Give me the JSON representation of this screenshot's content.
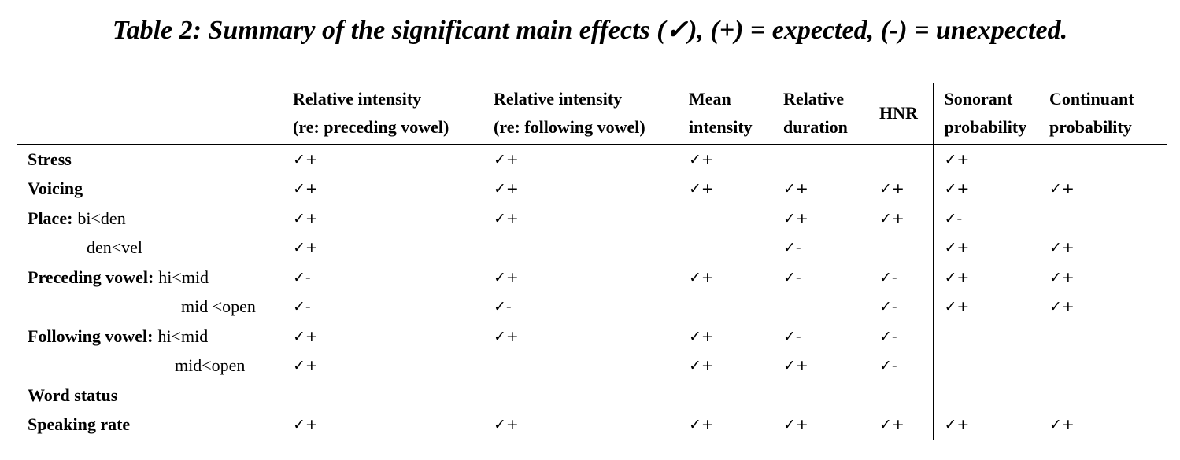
{
  "title": "Table 2: Summary of the significant main effects (✓), (+) = expected, (-) = unexpected.",
  "columns": [
    {
      "line1": "Relative intensity",
      "line2": "(re: preceding vowel)"
    },
    {
      "line1": "Relative intensity",
      "line2": "(re: following vowel)"
    },
    {
      "line1": "Mean",
      "line2": "intensity"
    },
    {
      "line1": "Relative",
      "line2": "duration"
    },
    {
      "line1": "HNR",
      "line2": ""
    },
    {
      "line1": "Sonorant",
      "line2": "probability"
    },
    {
      "line1": "Continuant",
      "line2": "probability"
    }
  ],
  "rows": [
    {
      "label_bold": "Stress",
      "label_sub": "",
      "cells": [
        "✓+",
        "✓+",
        "✓+",
        "",
        "",
        "✓+",
        ""
      ]
    },
    {
      "label_bold": "Voicing",
      "label_sub": "",
      "cells": [
        "✓+",
        "✓+",
        "✓+",
        "✓+",
        "✓+",
        "✓+",
        "✓+"
      ]
    },
    {
      "label_bold": "Place:",
      "label_sub": "bi<den",
      "cells": [
        "✓+",
        "✓+",
        "",
        "✓+",
        "✓+",
        "✓-",
        ""
      ]
    },
    {
      "label_bold": "",
      "label_sub": "den<vel",
      "cells": [
        "✓+",
        "",
        "",
        "✓-",
        "",
        "✓+",
        "✓+"
      ]
    },
    {
      "label_bold": "Preceding vowel:",
      "label_sub": "hi<mid",
      "cells": [
        "✓-",
        "✓+",
        "✓+",
        "✓-",
        "✓-",
        "✓+",
        "✓+"
      ]
    },
    {
      "label_bold": "",
      "label_sub": "mid <open",
      "cells": [
        "✓-",
        "✓-",
        "",
        "",
        "✓-",
        "✓+",
        "✓+"
      ]
    },
    {
      "label_bold": "Following vowel:",
      "label_sub": "hi<mid",
      "cells": [
        "✓+",
        "✓+",
        "✓+",
        "✓-",
        "✓-",
        "",
        ""
      ]
    },
    {
      "label_bold": "",
      "label_sub": "mid<open",
      "cells": [
        "✓+",
        "",
        "✓+",
        "✓+",
        "✓-",
        "",
        ""
      ]
    },
    {
      "label_bold": "Word status",
      "label_sub": "",
      "cells": [
        "",
        "",
        "",
        "",
        "",
        "",
        ""
      ]
    },
    {
      "label_bold": "Speaking rate",
      "label_sub": "",
      "cells": [
        "✓+",
        "✓+",
        "✓+",
        "✓+",
        "✓+",
        "✓+",
        "✓+"
      ]
    }
  ]
}
